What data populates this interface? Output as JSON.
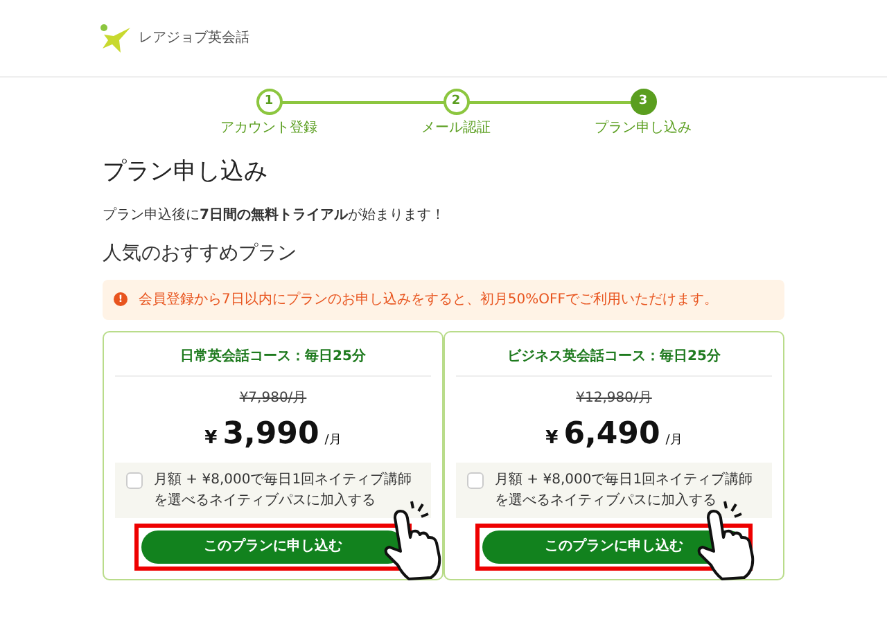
{
  "header": {
    "logo_text": "レアジョブ英会話"
  },
  "steps": [
    {
      "number": "1",
      "label": "アカウント登録",
      "selected": false
    },
    {
      "number": "2",
      "label": "メール認証",
      "selected": false
    },
    {
      "number": "3",
      "label": "プラン申し込み",
      "selected": true
    }
  ],
  "title": "プラン申し込み",
  "intro": "プラン申込後に**7日間の無料トライアル**が始まります！",
  "section_title": "人気のおすすめプラン",
  "notice": {
    "icon": "!",
    "text": "会員登録から7日以内にプランのお申し込みをすると、初月50%OFFでご利用いただけます。"
  },
  "plans": [
    {
      "name": "日常英会話コース：毎日25分",
      "old_price": "¥7,980/月",
      "currency": "¥",
      "price": "3,990",
      "unit": "/月",
      "option": {
        "label": "月額 + ¥8,000で毎日1回ネイティブ講師を選べるネイティブパスに加入する",
        "checked": false
      },
      "button": "このプランに申し込む"
    },
    {
      "name": "ビジネス英会話コース：毎日25分",
      "old_price": "¥12,980/月",
      "currency": "¥",
      "price": "6,490",
      "unit": "/月",
      "option": {
        "label": "月額 + ¥8,000で毎日1回ネイティブ講師を選べるネイティブパスに加入する",
        "checked": false
      },
      "button": "このプランに申し込む"
    }
  ]
}
